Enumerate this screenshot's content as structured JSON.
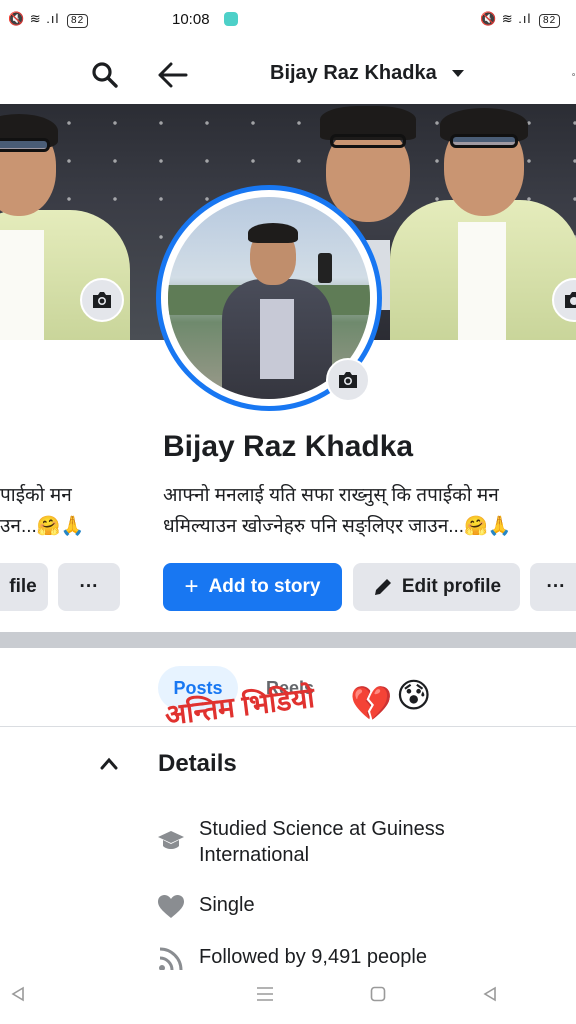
{
  "status_bar": {
    "time": "10:08",
    "battery_left": "82",
    "battery_right": "82"
  },
  "nav": {
    "profile_name": "Bijay Raz Khadka"
  },
  "profile": {
    "name": "Bijay Raz Khadka",
    "bio_line1": "आफ्नो मनलाई यति सफा राख्नुस् कि तपाईको मन",
    "bio_line2": "धमिल्याउन खोज्नेहरु पनि सङ्लिएर जाउन...🤗🙏",
    "left_bio_line1": "पाईको मन",
    "left_bio_line2": "उन...🤗🙏"
  },
  "buttons": {
    "add_to_story": "Add to story",
    "edit_profile": "Edit profile",
    "more": "···",
    "left_partial": "file"
  },
  "tabs": {
    "posts": "Posts",
    "reels": "Reels"
  },
  "overlay": {
    "caption": "अन्तिम भिडियो",
    "emoji1": "💔",
    "emoji2": "😰"
  },
  "details": {
    "title": "Details",
    "education": "Studied Science at Guiness International",
    "relationship": "Single",
    "followers": "Followed by 9,491 people"
  },
  "colors": {
    "fb_blue": "#1877f2",
    "grey_button": "#e4e6eb",
    "overlay_red": "#e0322f"
  }
}
